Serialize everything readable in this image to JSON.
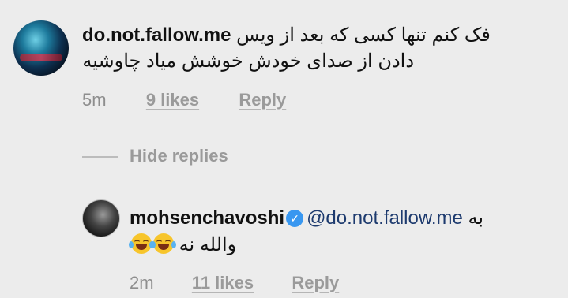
{
  "comments": [
    {
      "username": "do.not.fallow.me",
      "text_line1": "فک کنم تنها کسی که بعد از ویس",
      "text_line2": "دادن از صدای خودش خوشش میاد چاوشیه",
      "time": "5m",
      "likes": "9 likes",
      "reply": "Reply"
    }
  ],
  "hide_replies": "Hide replies",
  "replies": [
    {
      "username": "mohsenchavoshi",
      "verified": true,
      "mention": "@do.not.fallow.me",
      "prefix": "به",
      "text": "والله نه",
      "emoji": [
        "face-with-tears-of-joy",
        "face-with-tears-of-joy"
      ],
      "time": "2m",
      "likes": "11 likes",
      "reply": "Reply"
    }
  ],
  "colors": {
    "background": "#ececec",
    "meta_gray": "#8e8e8e",
    "verified_blue": "#3897f0",
    "mention_blue": "#1d3a6e"
  }
}
